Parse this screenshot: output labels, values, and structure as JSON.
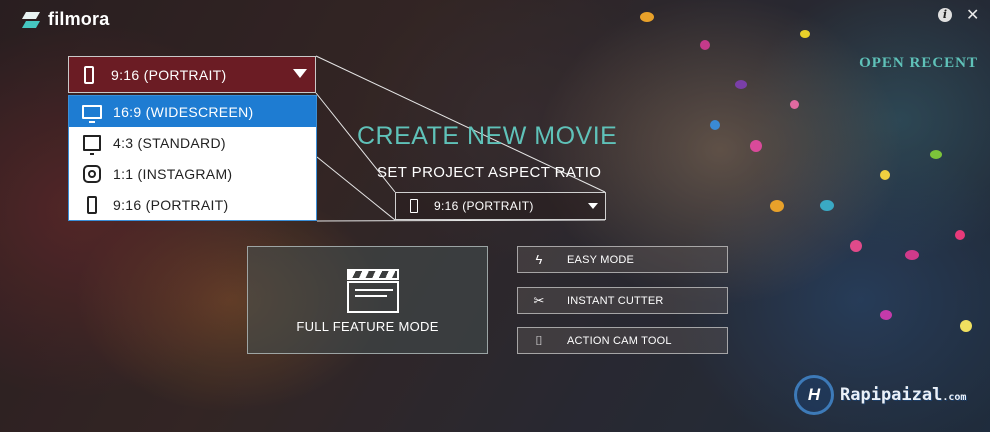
{
  "app": {
    "name": "filmora"
  },
  "header": {
    "info_icon": "info-icon",
    "close_icon": "close-icon",
    "open_recent": "OPEN RECENT"
  },
  "aspect_dropdown": {
    "selected": "9:16 (PORTRAIT)",
    "selected_icon": "phone-icon",
    "options": [
      {
        "label": "16:9 (WIDESCREEN)",
        "icon": "widescreen-monitor-icon",
        "highlighted": true
      },
      {
        "label": "4:3 (STANDARD)",
        "icon": "standard-monitor-icon",
        "highlighted": false
      },
      {
        "label": "1:1 (INSTAGRAM)",
        "icon": "instagram-icon",
        "highlighted": false
      },
      {
        "label": "9:16 (PORTRAIT)",
        "icon": "phone-icon",
        "highlighted": false
      }
    ]
  },
  "main": {
    "title": "CREATE NEW MOVIE",
    "subtitle": "SET PROJECT ASPECT RATIO",
    "aspect_value": "9:16 (PORTRAIT)",
    "full_feature_mode": "FULL FEATURE MODE",
    "buttons": [
      {
        "label": "EASY MODE",
        "icon": "lightning-icon"
      },
      {
        "label": "INSTANT CUTTER",
        "icon": "scissors-icon"
      },
      {
        "label": "ACTION CAM TOOL",
        "icon": "camera-icon"
      }
    ]
  },
  "watermark": {
    "badge": "H",
    "text": "Rapipaizal",
    "suffix": ".com"
  },
  "colors": {
    "accent": "#5fc2b9",
    "dropdown_head": "#6b1c24",
    "selection": "#1e7cd2"
  }
}
